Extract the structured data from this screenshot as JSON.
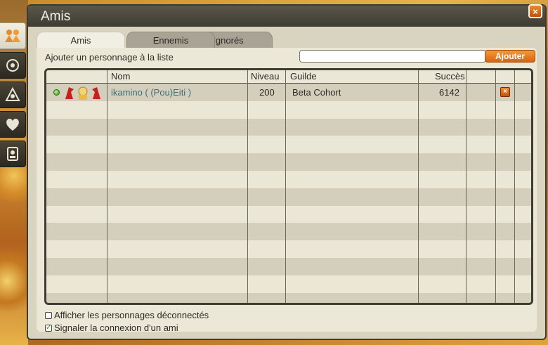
{
  "window": {
    "title": "Amis",
    "close_label": "×"
  },
  "sidebar": {
    "items": [
      {
        "icon": "friends-icon",
        "active": true
      },
      {
        "icon": "alliance-icon",
        "active": false
      },
      {
        "icon": "guild-icon",
        "active": false
      },
      {
        "icon": "heart-icon",
        "active": false
      },
      {
        "icon": "contacts-icon",
        "active": false
      }
    ]
  },
  "tabs": [
    {
      "label": "Amis",
      "active": true
    },
    {
      "label": "Ennemis",
      "active": false
    },
    {
      "label": "Ignorés",
      "active": false
    }
  ],
  "add_friend": {
    "label": "Ajouter un personnage à la liste",
    "input_value": "",
    "button_label": "Ajouter"
  },
  "table": {
    "columns": [
      "Nom",
      "Niveau",
      "Guilde",
      "Succès"
    ],
    "rows": [
      {
        "status": "online",
        "name": "ikamino ( (Pou)Eiti )",
        "level": "200",
        "guild": "Beta Cohort",
        "success": "6142",
        "delete_label": "×"
      }
    ],
    "empty_rows": 12
  },
  "options": {
    "show_offline_label": "Afficher les personnages déconnectés",
    "show_offline_checked": false,
    "notify_label": "Signaler la connexion d'un ami",
    "notify_checked": true
  },
  "colors": {
    "accent": "#e0711a",
    "online": "#3a9a1a",
    "name_link": "#3d6f78"
  }
}
